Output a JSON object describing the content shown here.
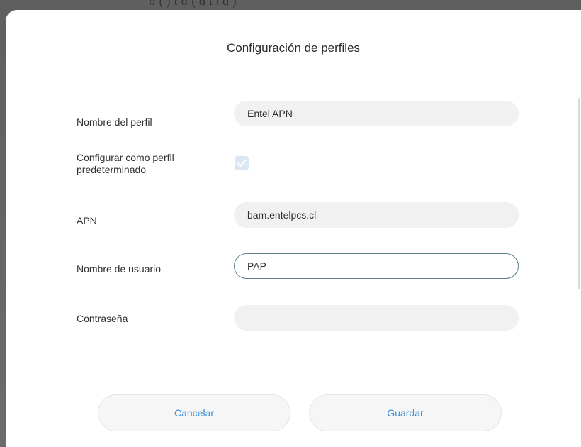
{
  "background": {
    "partial_text": "b ( ) t d ( d t i d )"
  },
  "dialog": {
    "title": "Configuración de perfiles",
    "fields": {
      "profile_name": {
        "label": "Nombre del perfil",
        "value": "Entel APN"
      },
      "default_profile": {
        "label_line1": "Configurar como perfil",
        "label_line2": "predeterminado",
        "checked": true
      },
      "apn": {
        "label": "APN",
        "value": "bam.entelpcs.cl"
      },
      "username": {
        "label": "Nombre de usuario",
        "value": "PAP"
      },
      "password": {
        "label": "Contraseña",
        "value": ""
      }
    },
    "buttons": {
      "cancel": "Cancelar",
      "save": "Guardar"
    }
  },
  "colors": {
    "accent": "#3c8fd6",
    "focus_border": "#5a7d8c",
    "field_bg": "#f1f1f1",
    "checkbox_bg": "#dbe8f4"
  }
}
